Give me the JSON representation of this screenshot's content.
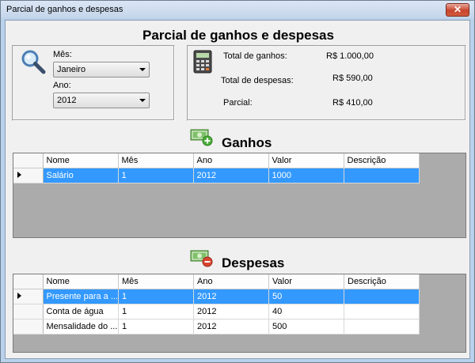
{
  "window": {
    "title": "Parcial de ganhos e despesas",
    "close_symbol": "✕"
  },
  "header": {
    "title": "Parcial de ganhos e despesas"
  },
  "filters": {
    "month_label": "Mês:",
    "month_value": "Janeiro",
    "year_label": "Ano:",
    "year_value": "2012"
  },
  "summary": {
    "total_ganhos_label": "Total de ganhos:",
    "total_ganhos_value": "R$ 1.000,00",
    "total_despesas_label": "Total de despesas:",
    "total_despesas_value": "R$ 590,00",
    "parcial_label": "Parcial:",
    "parcial_value": "R$ 410,00"
  },
  "ganhos": {
    "title": "Ganhos",
    "icon": "money-add-icon",
    "columns": [
      "Nome",
      "Mês",
      "Ano",
      "Valor",
      "Descrição"
    ],
    "rows": [
      {
        "nome": "Salário",
        "mes": "1",
        "ano": "2012",
        "valor": "1000",
        "descricao": ""
      }
    ]
  },
  "despesas": {
    "title": "Despesas",
    "icon": "money-remove-icon",
    "columns": [
      "Nome",
      "Mês",
      "Ano",
      "Valor",
      "Descrição"
    ],
    "rows": [
      {
        "nome": "Presente para a ...",
        "mes": "1",
        "ano": "2012",
        "valor": "50",
        "descricao": ""
      },
      {
        "nome": "Conta de água",
        "mes": "1",
        "ano": "2012",
        "valor": "40",
        "descricao": ""
      },
      {
        "nome": "Mensalidade do ...",
        "mes": "1",
        "ano": "2012",
        "valor": "500",
        "descricao": ""
      }
    ]
  },
  "colors": {
    "selection": "#3399ff",
    "grid_background": "#ababab",
    "window_frame": "#b9d1ea"
  }
}
